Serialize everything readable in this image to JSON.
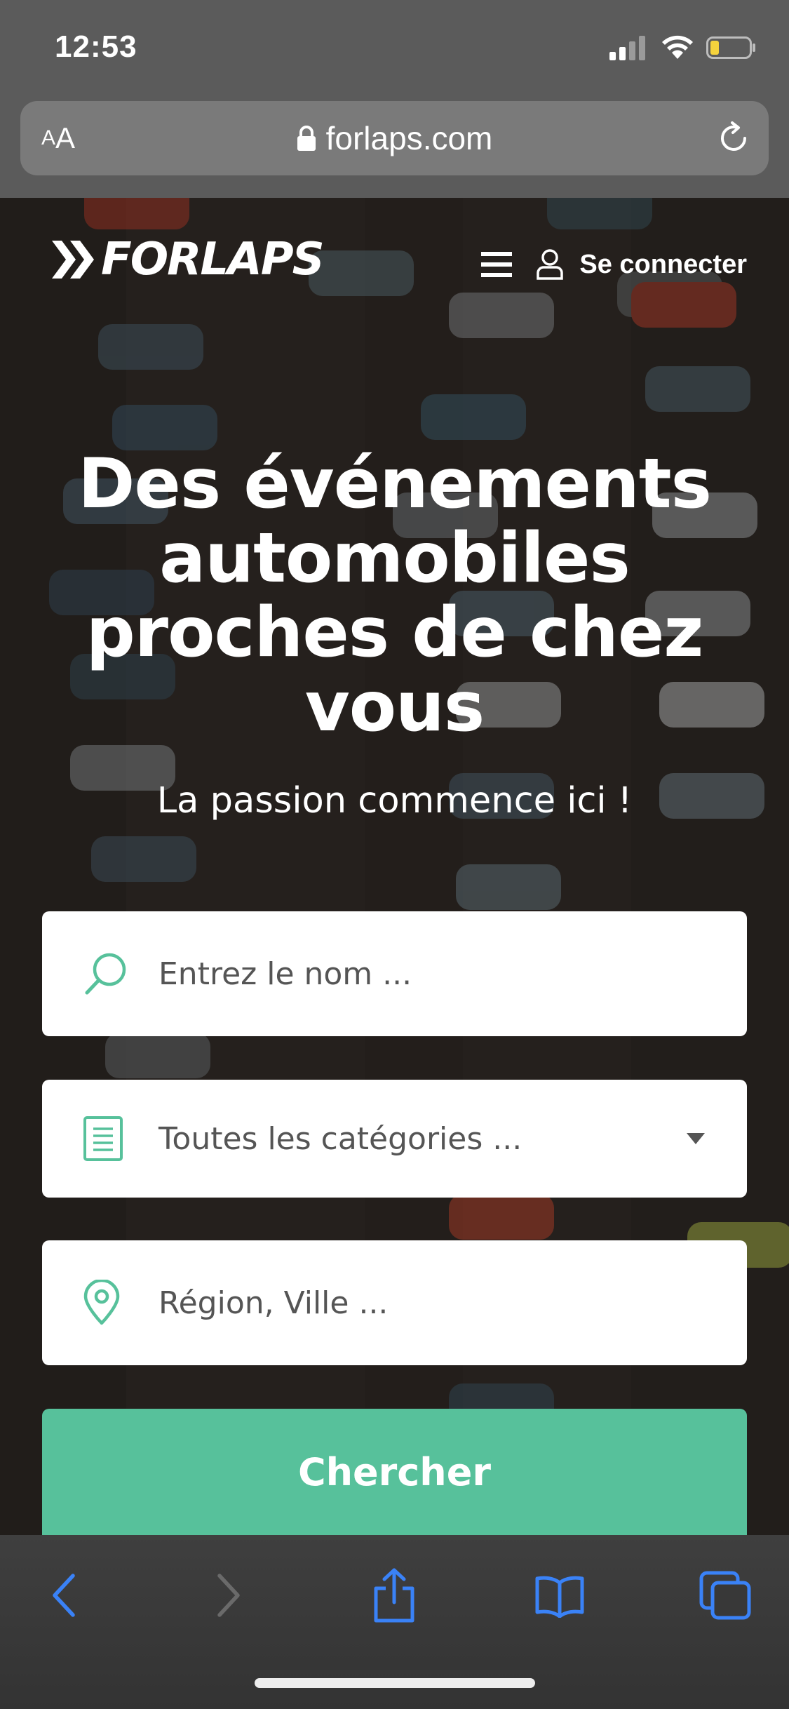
{
  "status_bar": {
    "time": "12:53"
  },
  "browser": {
    "aa_small": "A",
    "aa_large": "A",
    "url": "forlaps.com",
    "icons": [
      "signal-icon",
      "wifi-icon",
      "battery-icon",
      "lock-icon",
      "reload-icon"
    ]
  },
  "header": {
    "logo_text": "FORLAPS",
    "login_label": "Se connecter",
    "icons": [
      "logo-chevrons-icon",
      "menu-icon",
      "user-icon"
    ]
  },
  "hero": {
    "headline": "Des événements automobiles proches de chez vous",
    "subtitle": "La passion commence ici !"
  },
  "search_form": {
    "name_placeholder": "Entrez le nom ...",
    "category_placeholder": "Toutes les catégories ...",
    "location_placeholder": "Région, Ville ...",
    "submit_label": "Chercher",
    "icons": [
      "search-icon",
      "document-icon",
      "location-pin-icon",
      "dropdown-caret-icon"
    ]
  },
  "toolbar": {
    "icons": [
      "back-icon",
      "forward-icon",
      "share-icon",
      "bookmarks-icon",
      "tabs-icon"
    ]
  },
  "colors": {
    "accent": "#57c19b",
    "browser_chrome": "#5b5b5b",
    "toolbar_icon": "#3a82f7",
    "battery_low": "#f5d33d"
  }
}
